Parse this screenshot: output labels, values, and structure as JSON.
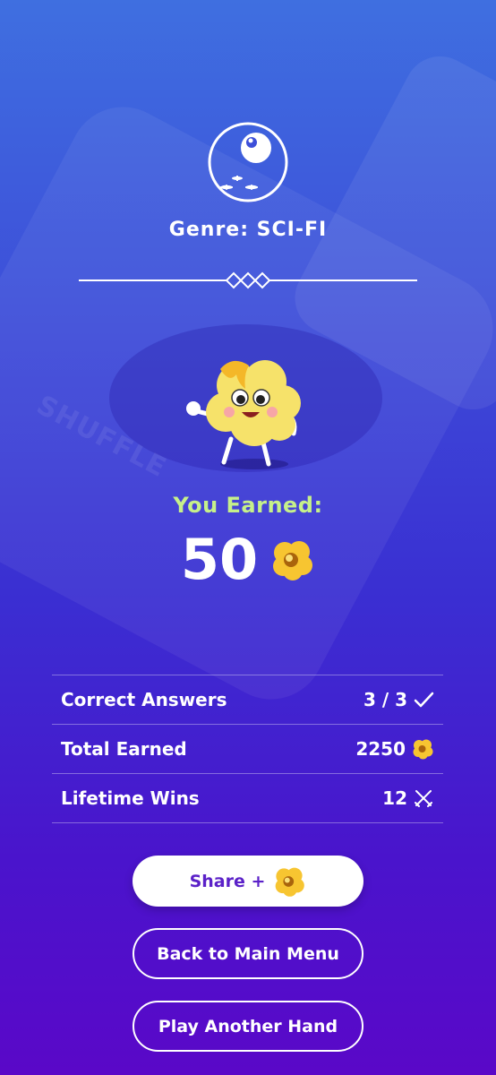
{
  "background": {
    "watermark": "SHUFFLE"
  },
  "header": {
    "genre_title": "Genre: SCI-FI",
    "genre_icon": "planet-ufo-icon"
  },
  "reward": {
    "mascot": "popcorn-mascot-thumbs-up",
    "label": "You Earned:",
    "amount": "50",
    "currency_icon": "popcorn-coin-icon"
  },
  "stats": [
    {
      "label": "Correct Answers",
      "value": "3 / 3",
      "icon": "check-icon"
    },
    {
      "label": "Total Earned",
      "value": "2250",
      "icon": "popcorn-coin-icon"
    },
    {
      "label": "Lifetime Wins",
      "value": "12",
      "icon": "crossed-swords-icon"
    }
  ],
  "buttons": {
    "share_label": "Share +",
    "back_label": "Back to Main Menu",
    "play_label": "Play Another Hand"
  },
  "colors": {
    "accent_green": "#c6f08a",
    "share_text": "#5b21c8",
    "coin": "#f7c531"
  }
}
